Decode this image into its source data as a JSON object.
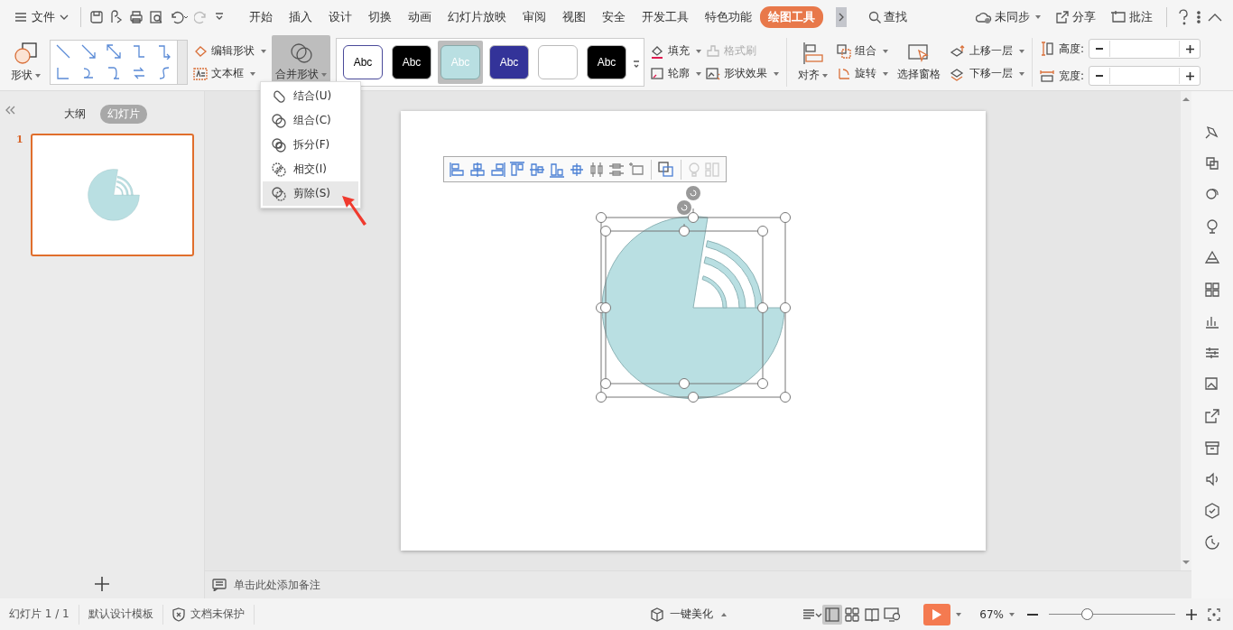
{
  "menu": {
    "label": "文件"
  },
  "tabs": [
    {
      "label": "开始",
      "selected": false
    },
    {
      "label": "插入",
      "selected": false
    },
    {
      "label": "设计",
      "selected": false
    },
    {
      "label": "切换",
      "selected": false
    },
    {
      "label": "动画",
      "selected": false
    },
    {
      "label": "幻灯片放映",
      "selected": false
    },
    {
      "label": "审阅",
      "selected": false
    },
    {
      "label": "视图",
      "selected": false
    },
    {
      "label": "安全",
      "selected": false
    },
    {
      "label": "开发工具",
      "selected": false
    },
    {
      "label": "特色功能",
      "selected": false
    },
    {
      "label": "绘图工具",
      "selected": true
    }
  ],
  "search": {
    "label": "查找"
  },
  "top_actions": [
    "未同步",
    "分享",
    "批注"
  ],
  "ribbon": {
    "shape": "形状",
    "edit_shape": "编辑形状",
    "text_box": "文本框",
    "merge_shapes": {
      "label": "合并形状",
      "pressed": true
    },
    "styles": [
      {
        "label": "Abc",
        "color": "#ffffff",
        "selected": false
      },
      {
        "label": "Abc",
        "color": "#000000",
        "selected": false
      },
      {
        "label": "Abc",
        "color": "#b9dfe2",
        "selected": true
      },
      {
        "label": "Abc",
        "color": "#333399",
        "selected": false
      },
      {
        "color": "#ffffff",
        "selected": false
      },
      {
        "label": "Abc",
        "color": "#000000",
        "selected": false
      }
    ],
    "fill": "填充",
    "format_painter": {
      "label": "格式刷",
      "disabled": true
    },
    "outline": "轮廓",
    "shape_effects": "形状效果",
    "align": "对齐",
    "group": "组合",
    "rotate": "旋转",
    "selection_pane": "选择窗格",
    "bring_forward": "上移一层",
    "send_backward": "下移一层",
    "height_label": "高度:",
    "width_label": "宽度:"
  },
  "merge_menu": [
    {
      "label": "结合(U)",
      "selected": false
    },
    {
      "label": "组合(C)",
      "selected": false
    },
    {
      "label": "拆分(F)",
      "selected": false
    },
    {
      "label": "相交(I)",
      "selected": false
    },
    {
      "label": "剪除(S)",
      "selected": true
    }
  ],
  "panel_tabs": [
    {
      "label": "大纲",
      "selected": false
    },
    {
      "label": "幻灯片",
      "selected": true
    }
  ],
  "slides": [
    {
      "number": "1",
      "selected": true
    }
  ],
  "notes_placeholder": "单击此处添加备注",
  "status_bar": {
    "slide": "幻灯片 1 / 1",
    "template": "默认设计模板",
    "protection": "文档未保护",
    "beautify": "一键美化",
    "zoom": "67%",
    "zoom_slider": {
      "level": 0.3
    }
  }
}
